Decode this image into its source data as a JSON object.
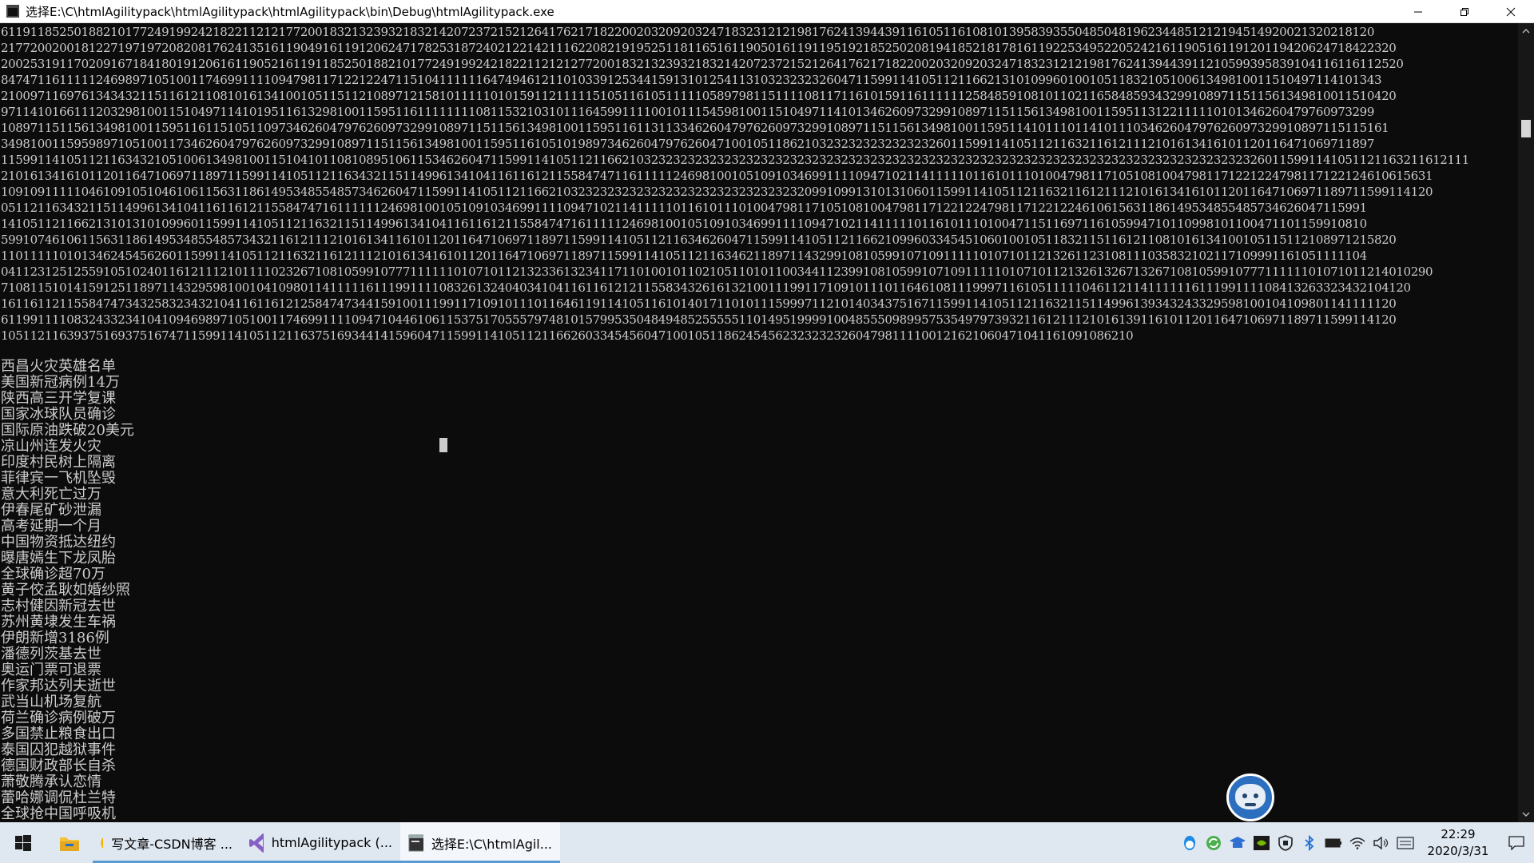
{
  "window": {
    "title": "选择E:\\C\\htmlAgilitypack\\htmlAgilitypack\\htmlAgilitypack\\bin\\Debug\\htmlAgilitypack.exe"
  },
  "console": {
    "digits": [
      "61191185250188210177249199242182211212177200183213239321832142072372152126417621718220020320920324718323121219817624139443911610511610810139583935504850481962344851212194514920021320218120",
      "21772002001812271971972082081762413516119049161191206247178253187240212214211162208219195251181165161190501611911951921852502081941852181781611922534952205242161190516119120119420624718422320",
      "200253191170209167184180191206161190521611911852501882101772491992421822112121277200183213239321832142072372152126417621718220020320920324718323121219817624139443911210599395839104116116112520",
      "847471161111124698971051001174699111109479811712212247115104111111647494612110103391253441591310125411310323232326047115991141051121166213101099601001051183210510061349810011510497114101343",
      "21009711697613434321151161211081016134100105115112108971215810111110101591121111151051161051111105897981151111081171161015911611111125848591081011021165848593432991089711511561349810011510420",
      "97114101661112032981001151049711410195116132981001159511611111111081153210310111645991111001011154598100115104971141013462609732991089711511561349810011595113122111110101346260479760973299",
      "1089711511561349810011595116115105110973462604797626097329910897115115613498100115951161131133462604797626097329910897115115613498100115951141011101141011103462604797626097329910897115115161",
      "34981001159598971051001173462604797626097329910897115115613498100115951161051019897346260479762604710010511862103232323232323232601159911410511211632116121112101613416101120116471069711897",
      "115991141051121163432105100613498100115104101108108951061153462604711599114105112116621032323232323232323232323232323232323232323232323232323232323232323232323232323232323260115991141051121163211612111",
      "2101613416101120116471069711897115991141051121163432115114996134104116116121155847471161111124698100105109103469911110947102114111110116101110100479811710510810047981171221224798117122124610615631",
      "1091091111104610910510461061156311861495348554857346260471159911410511211662103232323232323232323232323232323209910991310131060115991141051121163211612111210161341610112011647106971189711599114120",
      "0511211634321151149961341041161161211558474716111111246981001051091034699111109471021141111101161011101004798117105108100479811712212247981171221224610615631186149534855485734626047115991",
      "1410511211662131013101099601159911410511211632115114996134104116116121155847471611111246981001051091034699111109471021141111101161011101004711511697116105994710110998101100471101159910810",
      "59910746106115631186149534855485734321161211121016134116101120116471069711897115991141051121163462604711599114105112116621099603345451060100105118321151161211081016134100105115112108971215820",
      "1101111101013462454562601159911410511211632116121112101613416101120116471069711897115991141051121163462118971143299108105991071091111101071011213261123108111035832102117109991161051111104",
      "0411231251255910510240116121112101111023267108105991077711111101071011213233613234117110100101102105110101100344112399108105991071091111101071011213261326713267108105991077711111101071011214010290",
      "7108115101415912511897114329598100104109801141111161119911110832613240403410411611612121155834326161321001119911710910111011646108111999711610511111046112114111111611199111108413263323432104120",
      "16116112115584747343258323432104116116121258474734415910011199117109101110116461191141051161014017110101115999711210140343751671159911410511211632115114996139343243329598100104109801141111120",
      "61199111108324332341041094698971051001174699111109471044610611537517055579748101579953504849485255555110149519999100485550989957535497973932116121112101613911610112011647106971189711599114120",
      "10511211639375169375167471159911410511211637516934414159604711599114105112116626033454560471001051186245456232323232604798111100121621060471041161091086210"
    ],
    "headlines": [
      "西昌火灾英雄名单",
      "美国新冠病例14万",
      "陕西高三开学复课",
      "国家冰球队员确诊",
      "国际原油跌破20美元",
      "凉山州连发火灾",
      "印度村民树上隔离",
      "菲律宾一飞机坠毁",
      "意大利死亡过万",
      "伊春尾矿砂泄漏",
      "高考延期一个月",
      "中国物资抵达纽约",
      "曝唐嫣生下龙凤胎",
      "全球确诊超70万",
      "黄子佼孟耿如婚纱照",
      "志村健因新冠去世",
      "苏州黄埭发生车祸",
      "伊朗新增3186例",
      "潘德列茨基去世",
      "奥运门票可退票",
      "作家邦达列夫逝世",
      "武当山机场复航",
      "荷兰确诊病例破万",
      "多国禁止粮食出口",
      "泰国囚犯越狱事件",
      "德国财政部长自杀",
      "萧敬腾承认恋情",
      "蕾哈娜调侃杜兰特",
      "全球抢中国呼吸机"
    ]
  },
  "taskbar": {
    "tasks": [
      {
        "label": "写文章-CSDN博客 ...",
        "icon": "chrome-icon"
      },
      {
        "label": "htmlAgilitypack (...",
        "icon": "visual-studio-icon"
      },
      {
        "label": "选择E:\\C\\htmlAgil...",
        "icon": "console-icon"
      }
    ],
    "clock_time": "22:29",
    "clock_date": "2020/3/31"
  },
  "colors": {
    "console_bg": "#0c0c0c",
    "console_text": "#cccccc",
    "taskbar_bg": "#dfe7f1",
    "active_underline": "#5b9bd5"
  }
}
